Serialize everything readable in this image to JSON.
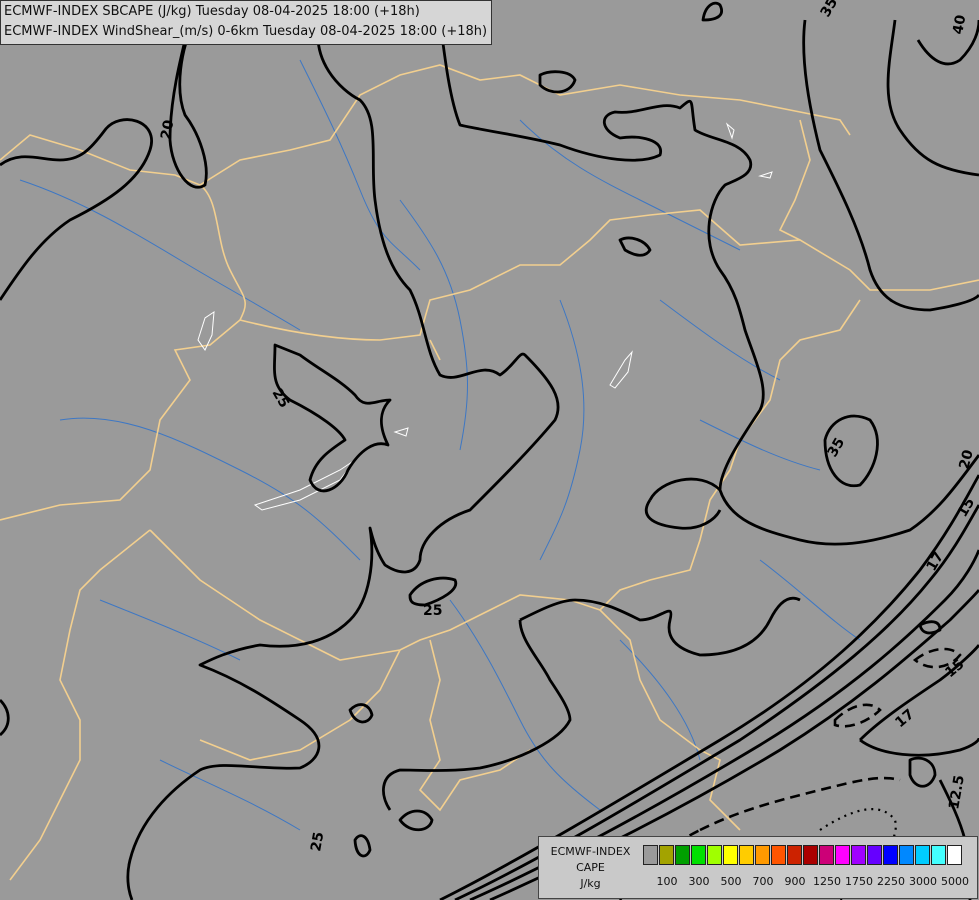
{
  "header": {
    "line1": "ECMWF-INDEX SBCAPE (J/kg) Tuesday 08-04-2025 18:00 (+18h)",
    "line2": "ECMWF-INDEX WindShear_(m/s) 0-6km Tuesday 08-04-2025 18:00 (+18h)"
  },
  "map": {
    "background": "#9a9a9a",
    "border_color": "#f2cf8f",
    "river_color": "#3d77c4",
    "contour_color": "#000000",
    "contour_labels": [
      "20",
      "25",
      "25",
      "25",
      "35",
      "35",
      "40",
      "20",
      "15",
      "17",
      "15",
      "17",
      "12.5"
    ]
  },
  "legend": {
    "title_lines": [
      "ECMWF-INDEX",
      "CAPE",
      "J/kg"
    ],
    "colors": [
      "#9a9a9a",
      "#a3a300",
      "#00a000",
      "#00e000",
      "#a0ff00",
      "#ffff00",
      "#ffcc00",
      "#ff9900",
      "#ff5500",
      "#cc2200",
      "#aa0000",
      "#cc0077",
      "#ff00ff",
      "#a000ff",
      "#6600ff",
      "#0000ff",
      "#0088ff",
      "#00ccff",
      "#44ffff",
      "#ffffff"
    ],
    "tick_labels": [
      "100",
      "300",
      "500",
      "700",
      "900",
      "1250",
      "1750",
      "2250",
      "3000",
      "5000"
    ]
  }
}
